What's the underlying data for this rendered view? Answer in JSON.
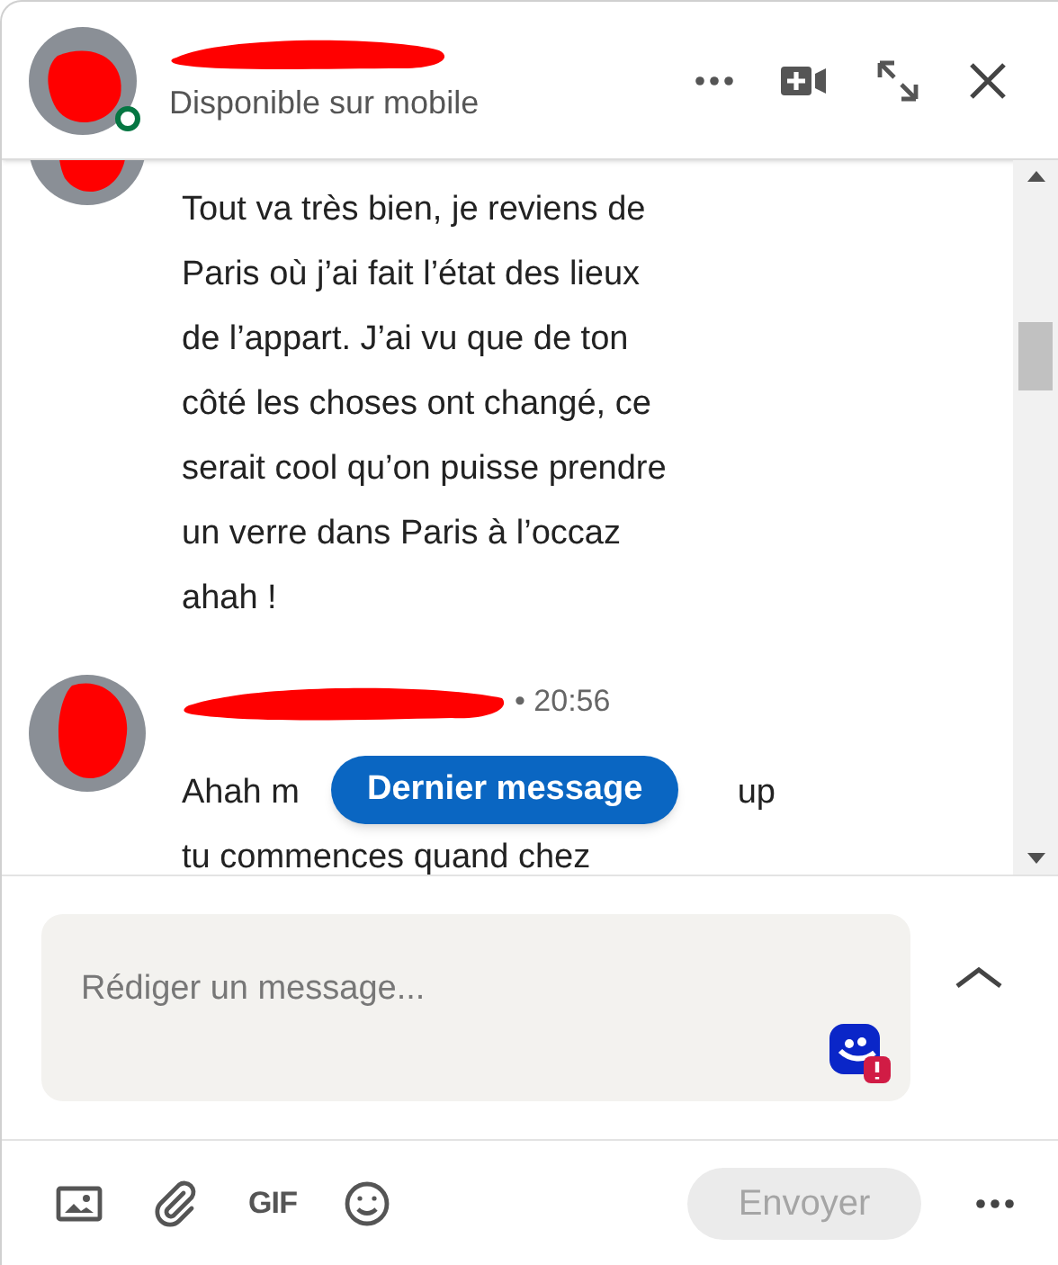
{
  "header": {
    "status": "Disponible sur mobile",
    "online": true
  },
  "messages": [
    {
      "lines": [
        [
          "Tout va très bien, je reviens de"
        ],
        [
          "Paris où j’ai fait l’état des lieux"
        ],
        [
          "de l’appart. J’ai vu que de ton"
        ],
        [
          "côté les choses ont changé, ce"
        ],
        [
          "serait cool qu’on puisse prendre"
        ],
        [
          "un verre dans Paris à l’occaz"
        ],
        [
          "ahah !"
        ]
      ]
    },
    {
      "time": "• 20:56",
      "lines": [
        [
          "Ahah m",
          "up"
        ],
        [
          "tu commences quand chez"
        ]
      ]
    }
  ],
  "jump_button": "Dernier message",
  "composer": {
    "placeholder": "Rédiger un message..."
  },
  "toolbar": {
    "gif": "GIF",
    "send": {
      "label": "Envoyer",
      "disabled": true
    }
  }
}
